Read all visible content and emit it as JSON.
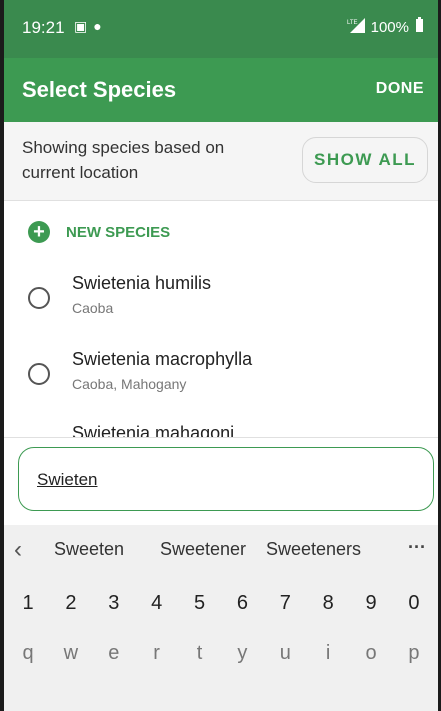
{
  "status": {
    "time": "19:21",
    "battery": "100%",
    "network": "LTE"
  },
  "appbar": {
    "title": "Select Species",
    "done_label": "DONE"
  },
  "filter": {
    "text": "Showing species based on current location",
    "show_all_label": "SHOW ALL"
  },
  "list": {
    "new_label": "NEW SPECIES",
    "items": [
      {
        "name": "Swietenia humilis",
        "common": "Caoba"
      },
      {
        "name": "Swietenia macrophylla",
        "common": "Caoba, Mahogany"
      },
      {
        "name": "Swietenia mahagoni",
        "common": ""
      }
    ]
  },
  "search": {
    "value": "Swieten"
  },
  "keyboard": {
    "suggestions": [
      "Sweeten",
      "Sweetener",
      "Sweeteners"
    ],
    "numbers": [
      "1",
      "2",
      "3",
      "4",
      "5",
      "6",
      "7",
      "8",
      "9",
      "0"
    ],
    "letters": [
      "q",
      "w",
      "e",
      "r",
      "t",
      "y",
      "u",
      "i",
      "o",
      "p"
    ]
  }
}
